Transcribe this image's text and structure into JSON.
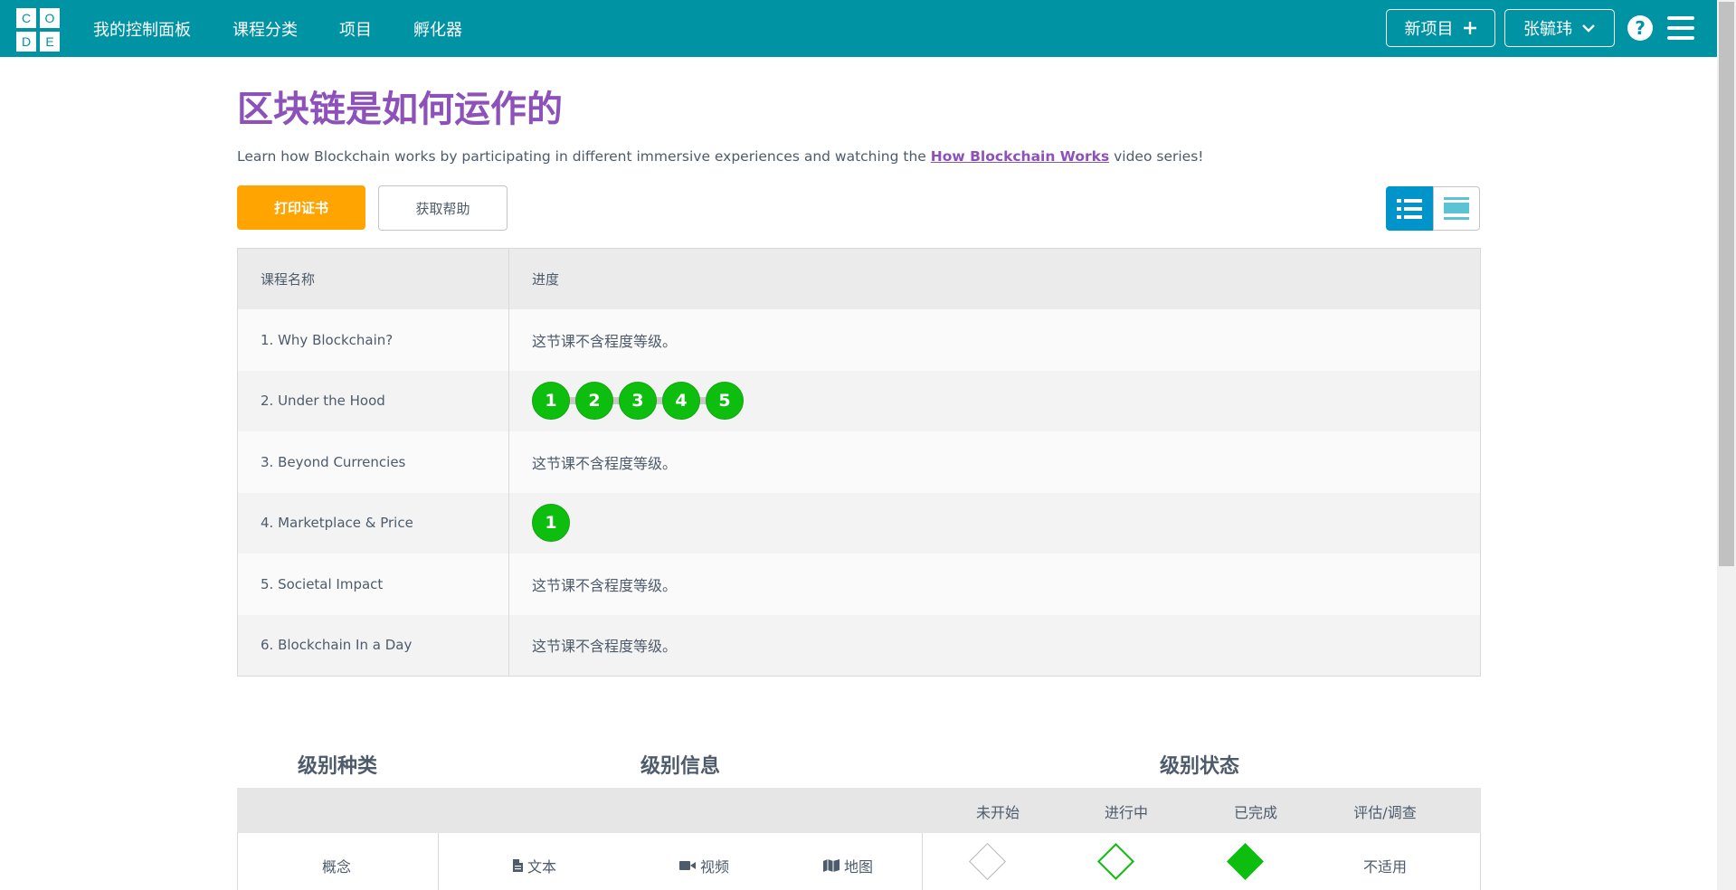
{
  "header": {
    "logo_letters": [
      "C",
      "O",
      "D",
      "E"
    ],
    "nav": [
      "我的控制面板",
      "课程分类",
      "项目",
      "孵化器"
    ],
    "new_project_label": "新项目",
    "user_label": "张毓玮",
    "help_icon": "?",
    "color": "#0093a4"
  },
  "page": {
    "title": "区块链是如何运作的",
    "description_before": "Learn how Blockchain works by participating in different immersive experiences and watching the ",
    "description_link": "How Blockchain Works",
    "description_after": " video series!",
    "print_button": "打印证书",
    "help_button": "获取帮助"
  },
  "lessons": {
    "header": {
      "name": "课程名称",
      "progress": "进度"
    },
    "no_levels_text": "这节课不含程度等级。",
    "rows": [
      {
        "name": "1. Why Blockchain?",
        "levels": []
      },
      {
        "name": "2. Under the Hood",
        "levels": [
          "1",
          "2",
          "3",
          "4",
          "5"
        ]
      },
      {
        "name": "3. Beyond Currencies",
        "levels": []
      },
      {
        "name": "4. Marketplace & Price",
        "levels": [
          "1"
        ]
      },
      {
        "name": "5. Societal Impact",
        "levels": []
      },
      {
        "name": "6. Blockchain In a Day",
        "levels": []
      }
    ]
  },
  "key": {
    "headings": {
      "type": "级别种类",
      "info": "级别信息",
      "status": "级别状态"
    },
    "status_labels": [
      "未开始",
      "进行中",
      "已完成",
      "评估/调查"
    ],
    "type_label": "概念",
    "info_items": [
      {
        "icon": "document-icon",
        "label": "文本"
      },
      {
        "icon": "video-icon",
        "label": "视频"
      },
      {
        "icon": "map-icon",
        "label": "地图"
      }
    ],
    "not_applicable": "不适用"
  }
}
